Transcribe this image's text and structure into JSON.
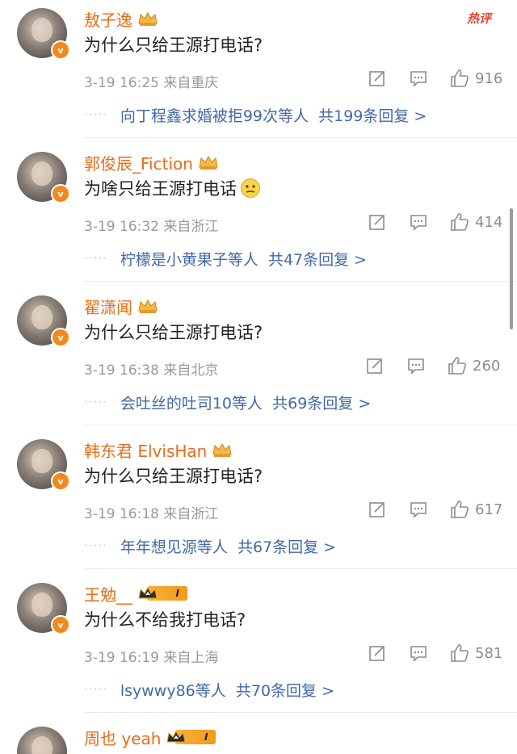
{
  "header_badge": "热评",
  "comments": [
    {
      "name": "敖子逸",
      "badge": "crown",
      "text": "为什么只给王源打电话?",
      "meta": "3-19 16:25 来自重庆",
      "likes": "916",
      "replies": "向丁程鑫求婚被拒99次等人",
      "reply_count": "共199条回复 >"
    },
    {
      "name": "郭俊辰_Fiction",
      "badge": "crown",
      "text": "为啥只给王源打电话",
      "emoji": "doubt-emoji",
      "meta": "3-19 16:32 来自浙江",
      "likes": "414",
      "replies": "柠檬是小黄果子等人",
      "reply_count": "共47条回复 >"
    },
    {
      "name": "翟潇闻",
      "badge": "crown",
      "text": "为什么只给王源打电话?",
      "meta": "3-19 16:38 来自北京",
      "likes": "260",
      "replies": "会吐丝的吐司10等人",
      "reply_count": "共69条回复 >"
    },
    {
      "name": "韩东君 ElvisHan",
      "badge": "crown",
      "text": "为什么只给王源打电话?",
      "meta": "3-19 16:18 来自浙江",
      "likes": "617",
      "replies": "年年想见源等人",
      "reply_count": "共67条回复 >"
    },
    {
      "name": "王勉__",
      "badge": "level",
      "level_text": "I",
      "text": "为什么不给我打电话?",
      "meta": "3-19 16:19 来自上海",
      "likes": "581",
      "replies": "lsywwy86等人",
      "reply_count": "共70条回复 >"
    },
    {
      "name": "周也 yeah",
      "badge": "level",
      "level_text": "I"
    }
  ],
  "colors": {
    "name": "#e86c17",
    "link": "#4169a6",
    "meta": "#9a9a9a",
    "accent": "#f08a1c"
  },
  "icons": [
    "edit-icon",
    "comment-icon",
    "like-icon"
  ]
}
